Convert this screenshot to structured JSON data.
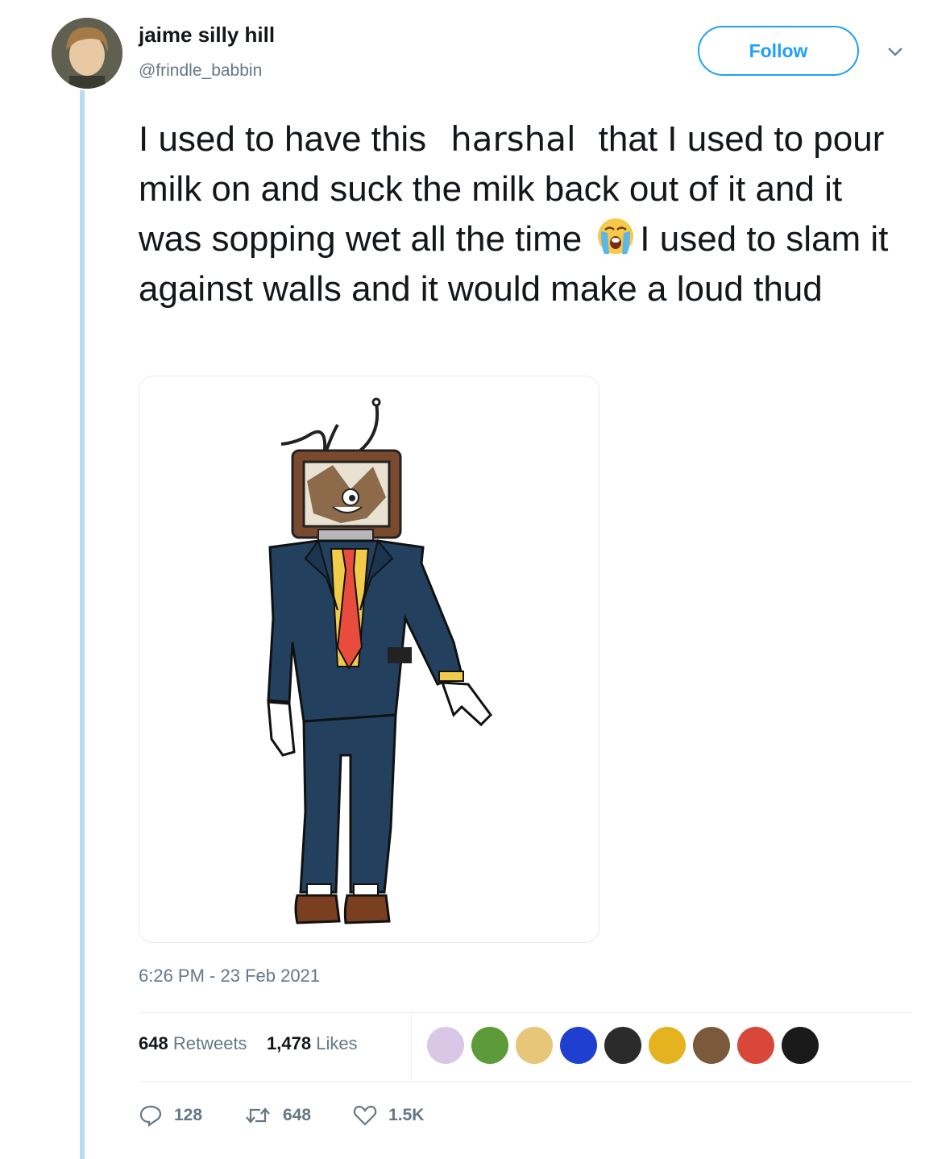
{
  "user": {
    "display_name": "jaime silly hill",
    "handle": "@frindle_babbin"
  },
  "follow_label": "Follow",
  "tweet": {
    "text_part1": "I used to have this",
    "inserted_word": "harshal",
    "text_part2": "that I used to pour milk on and suck the milk back out of it and it was sopping wet all the time",
    "emoji": "loudly-crying-face-emoji",
    "text_part3": "I used to slam it against walls and it would make a loud thud"
  },
  "timestamp": "6:26 PM - 23 Feb 2021",
  "stats": {
    "retweets_count": "648",
    "retweets_label": "Retweets",
    "likes_count": "1,478",
    "likes_label": "Likes"
  },
  "actions": {
    "replies": "128",
    "retweets": "648",
    "likes": "1.5K"
  },
  "colors": {
    "accent": "#1da1f2",
    "thread_line": "#b9dcf3",
    "secondary_text": "#657786"
  },
  "liker_avatars": [
    "#d9c7e6",
    "#5c9a3a",
    "#e7c67a",
    "#1f3fd1",
    "#2b2b2b",
    "#e6b320",
    "#7a5a3a",
    "#d9473a",
    "#1a1a1a"
  ]
}
